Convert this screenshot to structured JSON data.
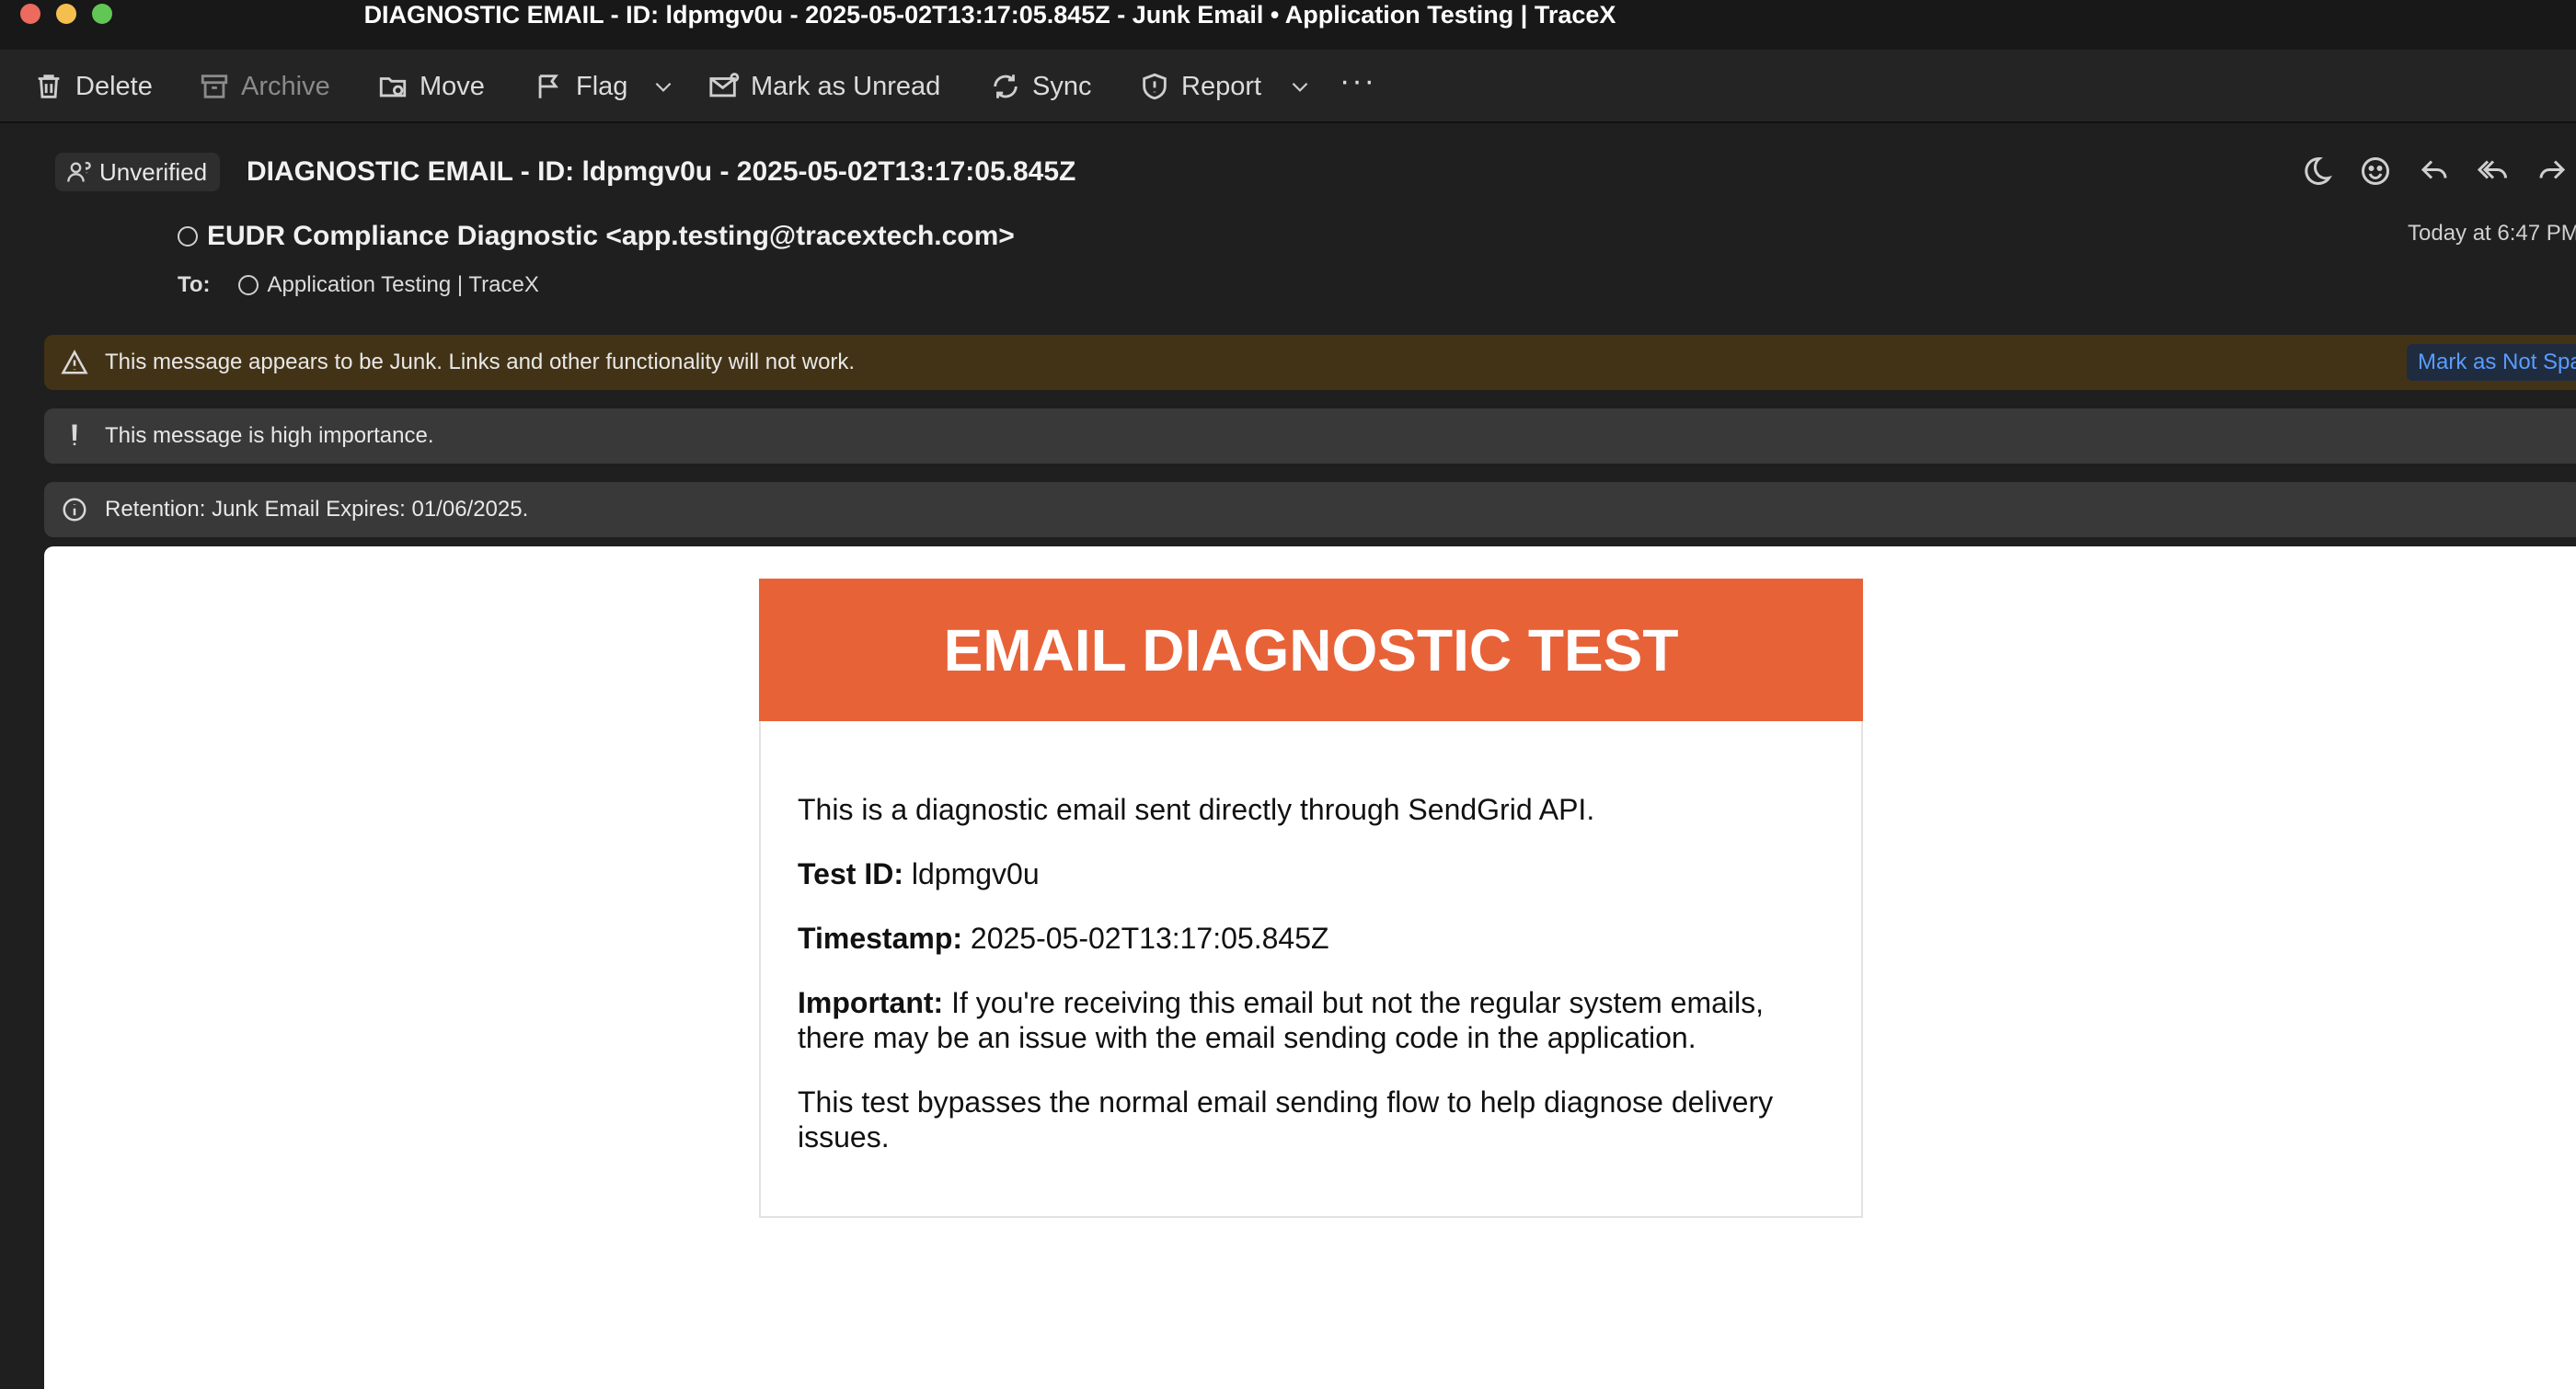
{
  "window": {
    "title": "DIAGNOSTIC EMAIL - ID: ldpmgv0u - 2025-05-02T13:17:05.845Z - Junk Email • Application Testing | TraceX"
  },
  "toolbar": {
    "delete": "Delete",
    "archive": "Archive",
    "move": "Move",
    "flag": "Flag",
    "mark_unread": "Mark as Unread",
    "sync": "Sync",
    "report": "Report",
    "more": "···"
  },
  "message": {
    "verification_badge": "Unverified",
    "subject": "DIAGNOSTIC EMAIL - ID: ldpmgv0u - 2025-05-02T13:17:05.845Z",
    "sender": "EUDR Compliance Diagnostic <app.testing@tracextech.com>",
    "date": "Today at 6:47 PM",
    "to_label": "To:",
    "to_value": "Application Testing | TraceX"
  },
  "banners": {
    "junk_text": "This message appears to be Junk. Links and other functionality will not work.",
    "not_spam_button": "Mark as Not Spam",
    "importance_text": "This message is high importance.",
    "retention_text": "Retention: Junk Email Expires: 01/06/2025."
  },
  "email_body": {
    "header_title": "EMAIL DIAGNOSTIC TEST",
    "intro": "This is a diagnostic email sent directly through SendGrid API.",
    "test_id_label": "Test ID:",
    "test_id_value": " ldpmgv0u",
    "timestamp_label": "Timestamp:",
    "timestamp_value": " 2025-05-02T13:17:05.845Z",
    "important_label": "Important:",
    "important_text": " If you're receiving this email but not the regular system emails, there may be an issue with the email sending code in the application.",
    "bypass_text": "This test bypasses the normal email sending flow to help diagnose delivery issues."
  },
  "colors": {
    "accent_orange": "#e86238",
    "junk_banner": "#433316",
    "link_blue": "#5a9cff"
  },
  "icons": {
    "delete": "trash-icon",
    "archive": "archive-box-icon",
    "move": "folder-move-icon",
    "flag": "flag-icon",
    "mark_unread": "envelope-dot-icon",
    "sync": "sync-icon",
    "report": "shield-icon"
  }
}
